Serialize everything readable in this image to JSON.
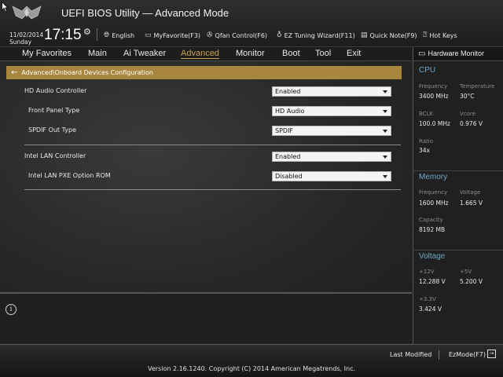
{
  "app": {
    "title": "UEFI BIOS Utility — Advanced Mode"
  },
  "datetime": {
    "date": "11/02/2014",
    "day": "Sunday",
    "time": "17:15"
  },
  "toolbar": {
    "language": "English",
    "my_favorite": "MyFavorite(F3)",
    "qfan": "Qfan Control(F6)",
    "ez_tuning": "EZ Tuning Wizard(F11)",
    "quick_note": "Quick Note(F9)",
    "hot_keys": "Hot Keys"
  },
  "menu": {
    "tabs": [
      {
        "label": "My Favorites"
      },
      {
        "label": "Main"
      },
      {
        "label": "Ai Tweaker"
      },
      {
        "label": "Advanced"
      },
      {
        "label": "Monitor"
      },
      {
        "label": "Boot"
      },
      {
        "label": "Tool"
      },
      {
        "label": "Exit"
      }
    ],
    "active": "Advanced"
  },
  "breadcrumb": "Advanced\\Onboard Devices Configuration",
  "settings": [
    {
      "label": "HD Audio Controller",
      "value": "Enabled"
    },
    {
      "label": "Front Panel Type",
      "value": "HD Audio"
    },
    {
      "label": "SPDIF Out Type",
      "value": "SPDIF"
    },
    {
      "label": "Intel LAN Controller",
      "value": "Enabled"
    },
    {
      "label": "Intel LAN PXE Option ROM",
      "value": "Disabled"
    }
  ],
  "hw_monitor": {
    "title": "Hardware Monitor",
    "cpu": {
      "section": "CPU",
      "frequency_label": "Frequency",
      "frequency": "3400 MHz",
      "temperature_label": "Temperature",
      "temperature": "30°C",
      "bclk_label": "BCLK",
      "bclk": "100.0 MHz",
      "vcore_label": "Vcore",
      "vcore": "0.976 V",
      "ratio_label": "Ratio",
      "ratio": "34x"
    },
    "memory": {
      "section": "Memory",
      "frequency_label": "Frequency",
      "frequency": "1600 MHz",
      "voltage_label": "Voltage",
      "voltage": "1.665 V",
      "capacity_label": "Capacity",
      "capacity": "8192 MB"
    },
    "voltage": {
      "section": "Voltage",
      "v12_label": "+12V",
      "v12": "12.288 V",
      "v5_label": "+5V",
      "v5": "5.200 V",
      "v33_label": "+3.3V",
      "v33": "3.424 V"
    }
  },
  "footer": {
    "last_modified": "Last Modified",
    "ez_mode": "EzMode(F7)",
    "version": "Version 2.16.1240. Copyright (C) 2014 American Megatrends, Inc."
  },
  "colors": {
    "accent": "#c8a24a",
    "breadcrumb_bg": "#a98640",
    "hw_section": "#6fa8c8"
  }
}
